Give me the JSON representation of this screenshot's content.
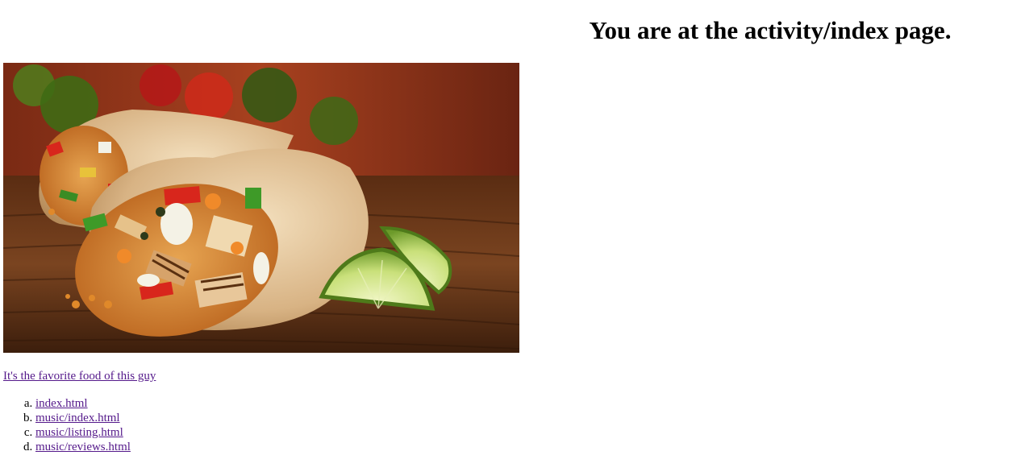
{
  "page": {
    "heading": "You are at the activity/index page."
  },
  "hero": {
    "subject": "burrito-photo"
  },
  "caption_link": {
    "label": "It's the favorite food of this guy"
  },
  "links": [
    {
      "label": "index.html"
    },
    {
      "label": "music/index.html"
    },
    {
      "label": "music/listing.html"
    },
    {
      "label": "music/reviews.html"
    }
  ],
  "colors": {
    "visited_link": "#551a8b",
    "text": "#000000",
    "background": "#ffffff"
  }
}
